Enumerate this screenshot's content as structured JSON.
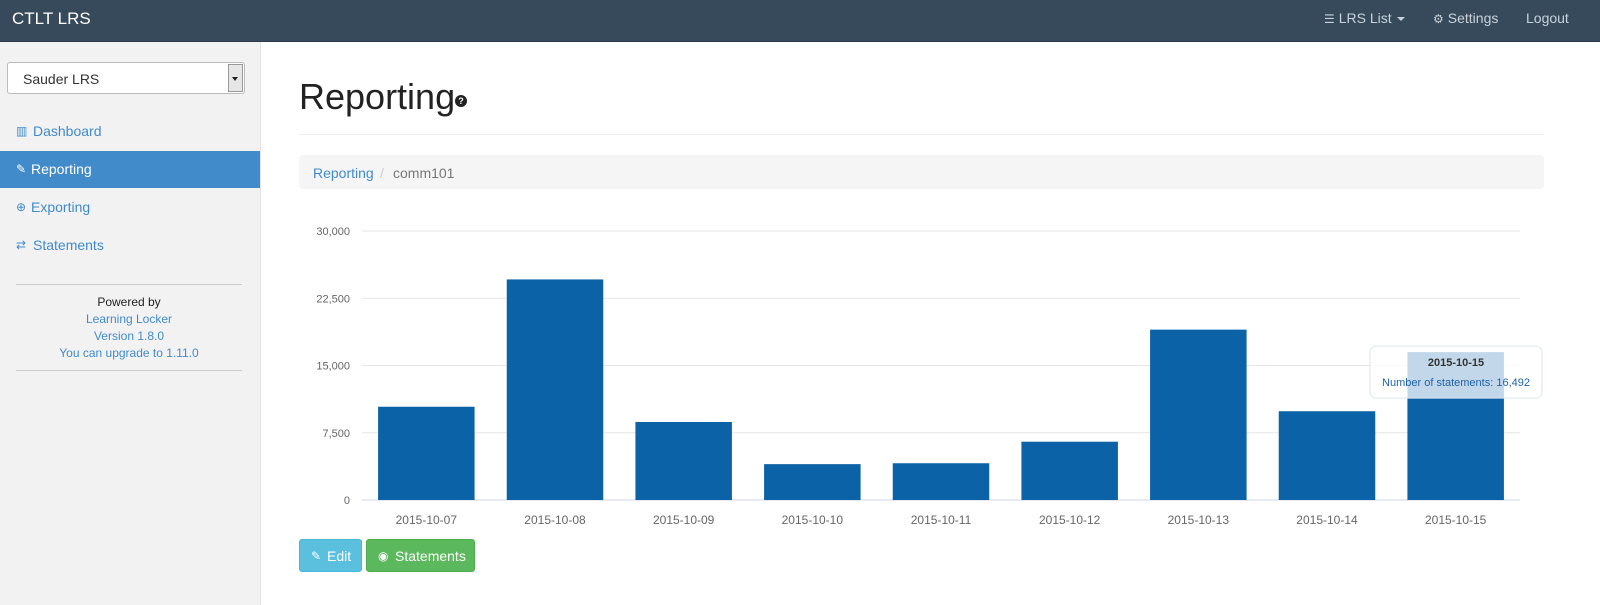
{
  "navbar": {
    "brand": "CTLT LRS",
    "lrs_list": "LRS List",
    "settings": "Settings",
    "logout": "Logout"
  },
  "sidebar": {
    "selected_lrs": "Sauder LRS",
    "items": [
      {
        "label": "Dashboard",
        "icon": "bar-chart-icon",
        "active": false
      },
      {
        "label": "Reporting",
        "icon": "pencil-icon",
        "active": true
      },
      {
        "label": "Exporting",
        "icon": "download-circle-icon",
        "active": false
      },
      {
        "label": "Statements",
        "icon": "exchange-icon",
        "active": false
      }
    ],
    "powered_by": "Powered by",
    "product": "Learning Locker",
    "version": "Version 1.8.0",
    "upgrade": "You can upgrade to 1.11.0"
  },
  "page": {
    "title": "Reporting",
    "breadcrumb": [
      "Reporting",
      "comm101"
    ],
    "breadcrumb_sep": "/"
  },
  "buttons": {
    "edit": "Edit",
    "statements": "Statements"
  },
  "colors": {
    "bar": "#0c62a6",
    "primary": "#428bca",
    "navbar": "#374a5b"
  },
  "chart_data": {
    "type": "bar",
    "categories": [
      "2015-10-07",
      "2015-10-08",
      "2015-10-09",
      "2015-10-10",
      "2015-10-11",
      "2015-10-12",
      "2015-10-13",
      "2015-10-14",
      "2015-10-15"
    ],
    "values": [
      10400,
      24600,
      8700,
      4000,
      4100,
      6500,
      19000,
      9900,
      16492
    ],
    "ylim": [
      0,
      30000
    ],
    "yticks": [
      "0",
      "7,500",
      "15,000",
      "22,500",
      "30,000"
    ],
    "ytick_values": [
      0,
      7500,
      15000,
      22500,
      30000
    ],
    "grid": true,
    "tooltip": {
      "title": "2015-10-15",
      "label": "Number of statements:",
      "value": "16,492"
    }
  }
}
